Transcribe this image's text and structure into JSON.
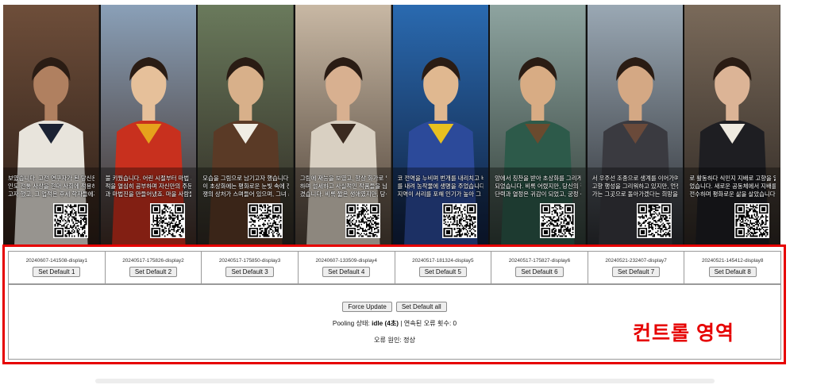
{
  "panels": [
    {
      "caption": [
        "보였습니다. 고전 연구자가 된 당신은",
        "인도 전통 사상을 현대 사회에 적용하",
        "고자 했고, 그 업적은 후세 학자들에게"
      ],
      "bg_top": "#6e4e3a",
      "bg_bottom": "#2a1d16",
      "fig": "#e8e4dc",
      "face": "#b08060",
      "accent": "#1b2233"
    },
    {
      "caption": [
        "불 키웠습니다. 어린 시절부터 마법 서",
        "적을 열심히 공부하며 자신만의 주문",
        "과 마법진을 만들어냈죠. 마을 사람들"
      ],
      "bg_top": "#8aa0b8",
      "bg_bottom": "#3c2a22",
      "fig": "#c8301e",
      "face": "#e6c09a",
      "accent": "#e6a21c"
    },
    {
      "caption": [
        "모습을 그림으로 남기고자 했습니다.",
        "이 초상화에는 평화로운 눈빛 속에 전",
        "쟁의 상처가 스며들어 있으며, 그녀 소"
      ],
      "bg_top": "#6a7a5c",
      "bg_bottom": "#2c2620",
      "fig": "#5a3a26",
      "face": "#d8b08a",
      "accent": "#f0ede4"
    },
    {
      "caption": [
        "그림에 재능을 보였고, 항상 화가로 일",
        "하며 섬세하고 사실적인 작품들을 남",
        "겼습니다. 비록 짧은 생애였지만, 당신"
      ],
      "bg_top": "#c8b8a4",
      "bg_bottom": "#4a3e34",
      "fig": "#d9d0c2",
      "face": "#d8b090",
      "accent": "#3a2a20"
    },
    {
      "caption": [
        "코 전역을 누비며 번개를 내리치고 비",
        "를 내려 농작물에 생명을 주었습니다.",
        "지역이 서리를 포해 인기가 높아 그"
      ],
      "bg_top": "#2a6ab0",
      "bg_bottom": "#0f1d3a",
      "fig": "#2c4a9a",
      "face": "#e0b890",
      "accent": "#e8c020"
    },
    {
      "caption": [
        "앙에서 칭찬을 받아 초상화를 그리게",
        "되었습니다. 비록 어렸지만, 당신의 결",
        "단력과 열정은 귀감이 되었고, 궁정 생"
      ],
      "bg_top": "#8ea4a0",
      "bg_bottom": "#2e3a34",
      "fig": "#2d5a4a",
      "face": "#d8ac84",
      "accent": "#6a4a2e"
    },
    {
      "caption": [
        "서 우주선 조종으로 생계를 이어가며",
        "고향 행성을 그리워하고 있지만, 언젠",
        "가는 그곳으로 돌아가겠다는 희망을 가"
      ],
      "bg_top": "#9aa8b4",
      "bg_bottom": "#2a2c30",
      "fig": "#3a3a40",
      "face": "#d4a884",
      "accent": "#6a4a3a"
    },
    {
      "caption": [
        "로 활동하다 식민지 지배로 고향을 잃",
        "었습니다. 새로운 공동체에서 지배를",
        "전수하며 평화로운 삶을 살았습니다."
      ],
      "bg_top": "#7a6a5a",
      "bg_bottom": "#2a2420",
      "fig": "#1e1e22",
      "face": "#dcb496",
      "accent": "#efeae0"
    }
  ],
  "displays": [
    {
      "id": "20240607-141508-display1",
      "button": "Set Default 1"
    },
    {
      "id": "20240517-175826-display2",
      "button": "Set Default 2"
    },
    {
      "id": "20240517-175850-display3",
      "button": "Set Default 3"
    },
    {
      "id": "20240607-133509-display4",
      "button": "Set Default 4"
    },
    {
      "id": "20240517-181324-display5",
      "button": "Set Default 5"
    },
    {
      "id": "20240517-175827-display6",
      "button": "Set Default 6"
    },
    {
      "id": "20240521-232407-display7",
      "button": "Set Default 7"
    },
    {
      "id": "20240521-145412-display8",
      "button": "Set Default 8"
    }
  ],
  "controls": {
    "force_update": "Force Update",
    "set_default_all": "Set Default all",
    "pooling_label": "Pooling 상태:",
    "pooling_value": "idle (4초)",
    "error_count_label": "| 연속된 오류 횟수: 0",
    "error_cause": "오류 원인: 정상"
  },
  "annotation": {
    "label": "컨트롤 영역",
    "color": "#e60000"
  }
}
